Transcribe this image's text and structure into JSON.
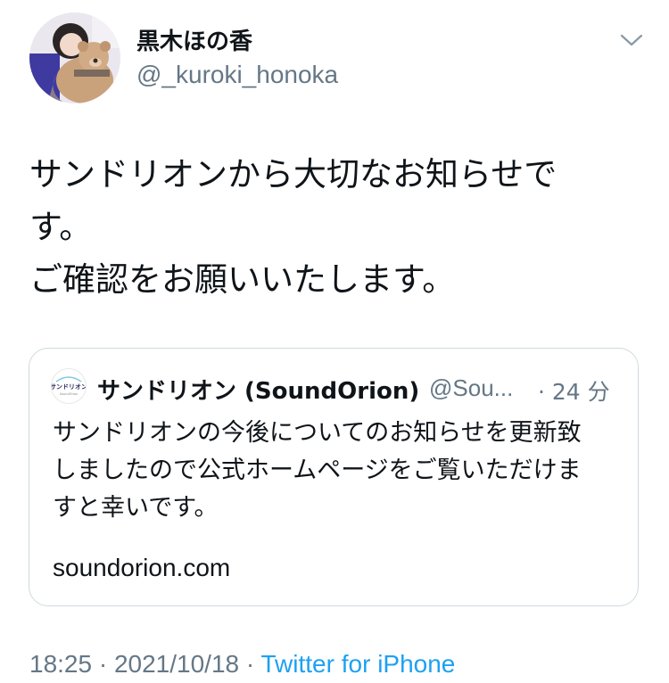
{
  "author": {
    "display_name": "黒木ほの香",
    "handle": "@_kuroki_honoka"
  },
  "tweet": {
    "lines": [
      "サンドリオンから大切なお知らせで",
      "す。",
      "ご確認をお願いいたします。"
    ]
  },
  "quoted_tweet": {
    "display_name": "サンドリオン (SoundOrion)",
    "handle": "@Sou...",
    "time": "· 24 分",
    "lines": [
      "サンドリオンの今後についてのお知らせを更新致",
      "しましたので公式ホームページをご覧いただけま",
      "すと幸いです。"
    ],
    "link": "soundorion.com",
    "avatar_logo_text": "サンドリオン"
  },
  "footer": {
    "time": "18:25",
    "date": "2021/10/18",
    "separator": "·",
    "source": "Twitter for iPhone"
  },
  "icons": {
    "more": "chevron-down-icon"
  },
  "colors": {
    "primary_text": "#0f1419",
    "secondary_text": "#657786",
    "link": "#1da1f2",
    "border": "#cfd9de"
  }
}
